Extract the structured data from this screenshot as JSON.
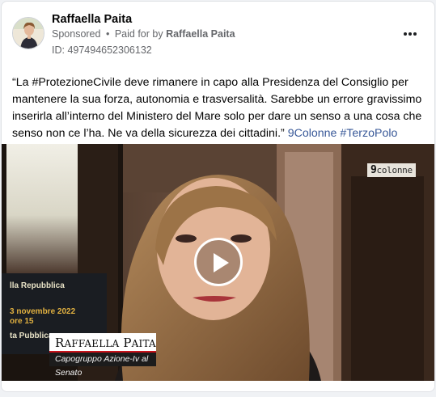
{
  "ad": {
    "page_name": "Raffaella Paita",
    "sponsored_label": "Sponsored",
    "separator": "•",
    "paid_for_prefix": "Paid for by",
    "paid_for_by": "Raffaella Paita",
    "ad_id": "ID: 497494652306132",
    "more_icon": "more-options-icon"
  },
  "post": {
    "text_main": "“La #ProtezioneCivile deve rimanere in capo alla Presidenza del Consiglio per mantenere la sua forza, autonomia e trasversalità. Sarebbe un errore gravissimo inserirla all’interno del Ministero del Mare solo per dare un senso a una cosa che senso non ce l’ha. Ne va della sicurezza dei cittadini.”",
    "tags": [
      "9Colonne",
      "#TerzoPolo"
    ]
  },
  "video": {
    "watermark_digit": "9",
    "watermark_text": "colonne",
    "lower_third_first": "R",
    "lower_third_first_rest": "AFFAELLA",
    "lower_third_last": "P",
    "lower_third_last_rest": "AITA",
    "lower_third_role": "Capogruppo Azione-Iv al Senato",
    "screen_lines": [
      "lla Repubblica",
      "3 novembre 2022",
      "ore 15",
      "ta Pubblica"
    ],
    "play_icon": "play-icon"
  },
  "colors": {
    "link": "#385898",
    "secondary_text": "#65676b",
    "lower_third_accent": "#c9121b"
  }
}
